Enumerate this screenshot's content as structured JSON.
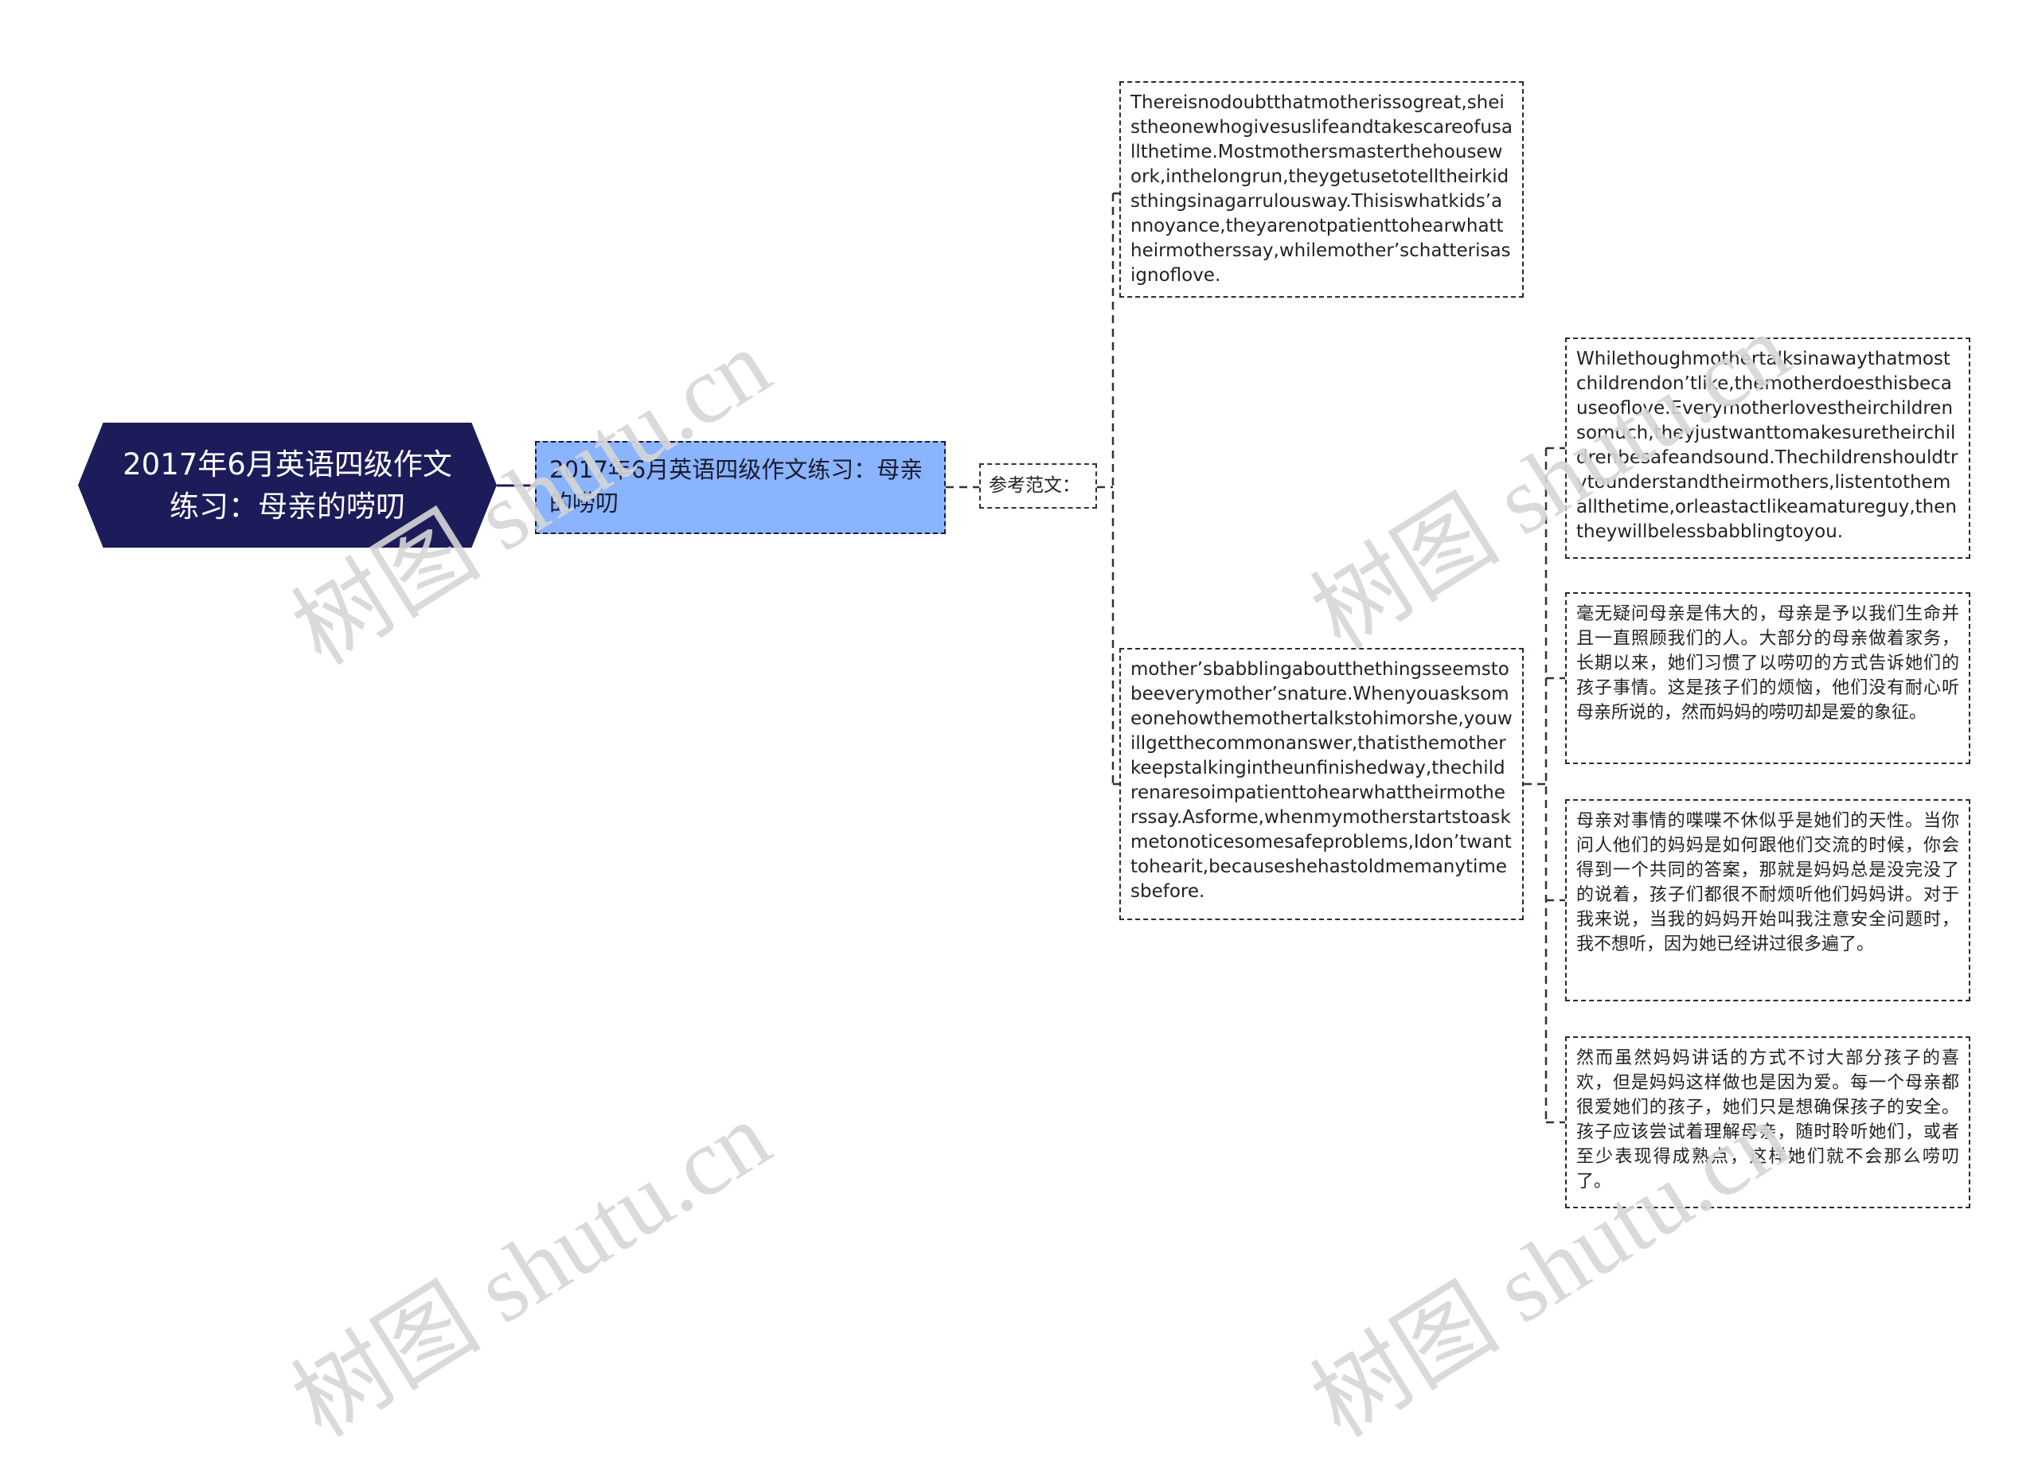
{
  "mindmap": {
    "root": {
      "title": "2017年6月英语四级作文练习：母亲的唠叨",
      "fill_color": "#1c1c5a",
      "text_color": "#ffffff"
    },
    "topic": {
      "title": "2017年6月英语四级作文练习：母亲的唠叨",
      "fill_color": "#8ab4fd"
    },
    "subtopic": {
      "label": "参考范文："
    },
    "english_paragraphs": [
      "Thereisnodoubtthatmotherissogreat,sheistheonewhogivesuslifeandtakescareofusallthetime.Mostmothersmasterthehousework,inthelongrun,theygetusetotelltheirkidsthingsinagarrulousway.Thisiswhatkids’annoyance,theyarenotpatienttohearwhattheirmotherssay,whilemother’schatterisasignoflove.",
      "mother’sbabblingaboutthethingsseemstobeeverymother’snature.Whenyouasksomeonehowthemothertalkstohimorshe,youwillgetthecommonanswer,thatisthemotherkeepstalkingintheunfinishedway,thechildrenaresoimpatienttohearwhattheirmotherssay.Asforme,whenmymotherstartstoaskmetonoticesomesafeproblems,Idon’twanttohearit,becauseshehastoldmemanytimesbefore."
    ],
    "right_column": [
      "Whilethoughmothertalksinawaythatmostchildrendon’tlike,themotherdoesthisbecauseoflove.Everymotherlovestheirchildrensomuch,theyjustwanttomakesuretheirchildrenbesafeandsound.Thechildrenshouldtrytounderstandtheirmothers,listentothemallthetime,orleastactlikeamatureguy,thentheywillbelessbabblingtoyou.",
      "毫无疑问母亲是伟大的，母亲是予以我们生命并且一直照顾我们的人。大部分的母亲做着家务，长期以来，她们习惯了以唠叨的方式告诉她们的孩子事情。这是孩子们的烦恼，他们没有耐心听母亲所说的，然而妈妈的唠叨却是爱的象征。",
      "母亲对事情的喋喋不休似乎是她们的天性。当你问人他们的妈妈是如何跟他们交流的时候，你会得到一个共同的答案，那就是妈妈总是没完没了的说着，孩子们都很不耐烦听他们妈妈讲。对于我来说，当我的妈妈开始叫我注意安全问题时，我不想听，因为她已经讲过很多遍了。",
      "然而虽然妈妈讲话的方式不讨大部分孩子的喜欢，但是妈妈这样做也是因为爱。每一个母亲都很爱她们的孩子，她们只是想确保孩子的安全。孩子应该尝试着理解母亲，随时聆听她们，或者至少表现得成熟点，这样她们就不会那么唠叨了。"
    ]
  },
  "watermark": {
    "text": "树图 shutu.cn"
  }
}
